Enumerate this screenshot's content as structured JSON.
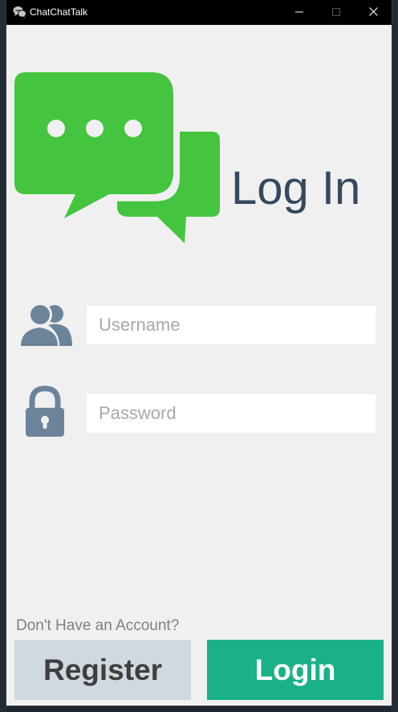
{
  "window": {
    "title": "ChatChatTalk"
  },
  "header": {
    "title": "Log In"
  },
  "form": {
    "username_placeholder": "Username",
    "username_value": "",
    "password_placeholder": "Password",
    "password_value": ""
  },
  "footer": {
    "no_account_text": "Don't Have an Account?",
    "register_label": "Register",
    "login_label": "Login"
  },
  "icons": {
    "app": "chat-bubbles-icon",
    "logo": "chat-bubbles-logo",
    "user": "users-icon",
    "lock": "lock-icon",
    "minimize": "minimize-icon",
    "maximize": "maximize-icon",
    "close": "close-icon"
  },
  "colors": {
    "logo_green": "#44c43f",
    "heading": "#34495e",
    "icon_slate": "#6b8499",
    "login_button": "#1ab188",
    "register_button": "#cfd9df",
    "client_background": "#f0f0f0"
  }
}
